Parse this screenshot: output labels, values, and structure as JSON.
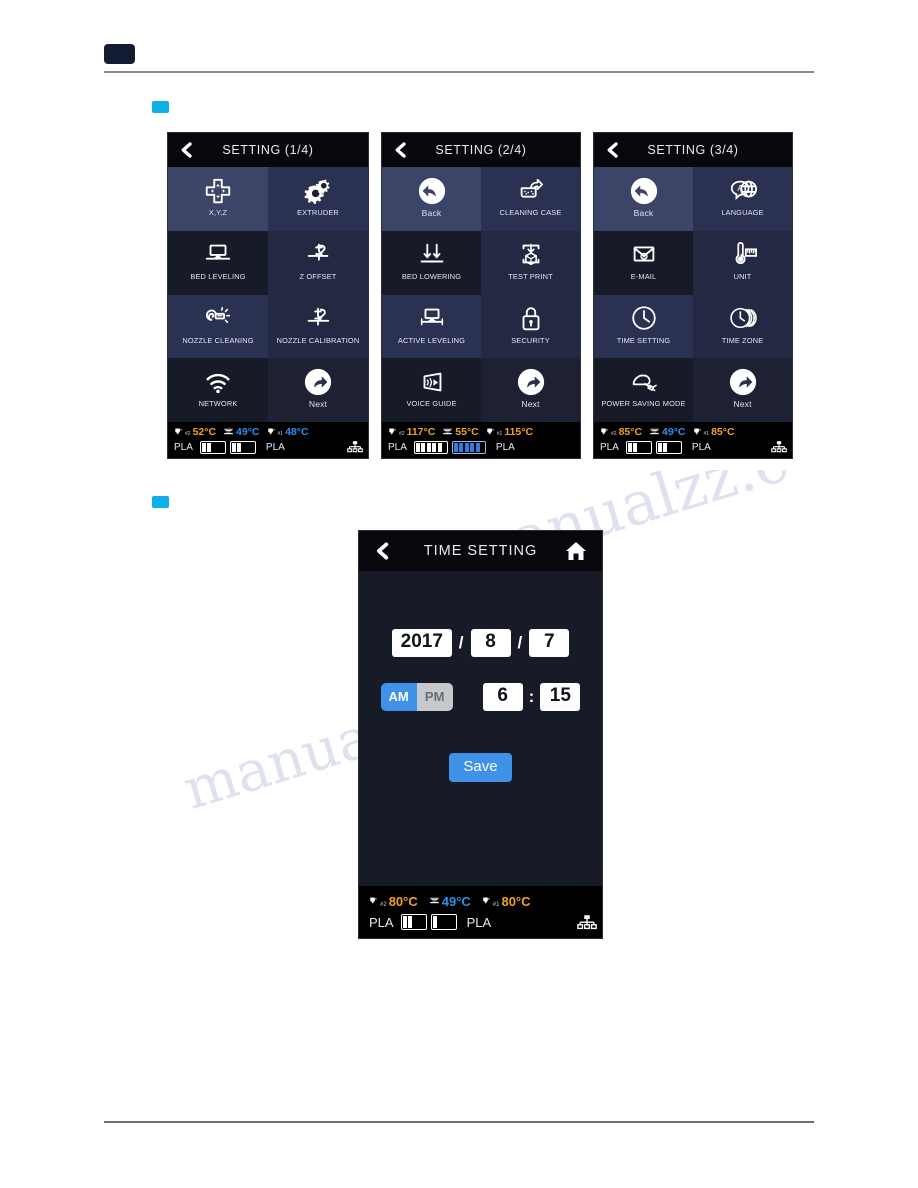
{
  "document": {
    "header_block": "",
    "section_markers": [
      "",
      ""
    ]
  },
  "watermark": {
    "line1": "manualzz",
    "line2": "manualzz.com"
  },
  "screens": [
    {
      "id": "setting-1-4",
      "title": "SETTING (1/4)",
      "back_icon": "chevron-left-icon",
      "tiles": [
        {
          "label": "X,Y,Z",
          "icon": "dpad-icon",
          "shade": "tA",
          "size": "small"
        },
        {
          "label": "EXTRUDER",
          "icon": "gears-icon",
          "shade": "tB",
          "size": "small"
        },
        {
          "label": "BED LEVELING",
          "icon": "bed-leveling-icon",
          "shade": "tC",
          "size": "small"
        },
        {
          "label": "Z OFFSET",
          "icon": "z-offset-icon",
          "shade": "tD",
          "size": "small"
        },
        {
          "label": "NOZZLE CLEANING",
          "icon": "nozzle-cleaning-icon",
          "shade": "tB",
          "size": "small"
        },
        {
          "label": "NOZZLE CALIBRATION",
          "icon": "nozzle-calibration-icon",
          "shade": "tD",
          "size": "small"
        },
        {
          "label": "NETWORK",
          "icon": "wifi-icon",
          "shade": "tC",
          "size": "small"
        },
        {
          "label": "Next",
          "icon": "next-arrow-icon",
          "shade": "tE",
          "size": "mix"
        }
      ],
      "status": {
        "temps": [
          {
            "sub": "#2",
            "value": "52°C",
            "icon": "nozzle-icon",
            "tone": "hot"
          },
          {
            "sub": "",
            "value": "49°C",
            "icon": "bed-icon",
            "tone": "cool"
          },
          {
            "sub": "#1",
            "value": "48°C",
            "icon": "nozzle-icon",
            "tone": "cool"
          }
        ],
        "left_material": "PLA",
        "right_material": "PLA",
        "bar_left_segments": 2,
        "bar_right_segments": 2,
        "bar_left_style": "white",
        "bar_right_style": "white",
        "network_icon": "ethernet-icon",
        "show_network": true
      }
    },
    {
      "id": "setting-2-4",
      "title": "SETTING (2/4)",
      "back_icon": "chevron-left-icon",
      "tiles": [
        {
          "label": "Back",
          "icon": "back-arrow-icon",
          "shade": "tA",
          "size": "mix"
        },
        {
          "label": "CLEANING CASE",
          "icon": "cleaning-case-icon",
          "shade": "tB",
          "size": "small"
        },
        {
          "label": "BED LOWERING",
          "icon": "bed-lowering-icon",
          "shade": "tC",
          "size": "small"
        },
        {
          "label": "TEST PRINT",
          "icon": "test-print-icon",
          "shade": "tD",
          "size": "small"
        },
        {
          "label": "ACTIVE LEVELING",
          "icon": "active-leveling-icon",
          "shade": "tB",
          "size": "small"
        },
        {
          "label": "SECURITY",
          "icon": "lock-icon",
          "shade": "tD",
          "size": "small"
        },
        {
          "label": "VOICE GUIDE",
          "icon": "voice-guide-icon",
          "shade": "tC",
          "size": "small"
        },
        {
          "label": "Next",
          "icon": "next-arrow-icon",
          "shade": "tE",
          "size": "mix"
        }
      ],
      "status": {
        "temps": [
          {
            "sub": "#2",
            "value": "117°C",
            "icon": "nozzle-icon",
            "tone": "hot"
          },
          {
            "sub": "",
            "value": "55°C",
            "icon": "bed-icon",
            "tone": "hot"
          },
          {
            "sub": "#1",
            "value": "115°C",
            "icon": "nozzle-icon",
            "tone": "hot"
          }
        ],
        "left_material": "PLA",
        "right_material": "PLA",
        "bar_left_segments": 5,
        "bar_right_segments": 5,
        "bar_left_style": "white",
        "bar_right_style": "blue",
        "network_icon": "ethernet-icon",
        "show_network": false
      }
    },
    {
      "id": "setting-3-4",
      "title": "SETTING (3/4)",
      "back_icon": "chevron-left-icon",
      "tiles": [
        {
          "label": "Back",
          "icon": "back-arrow-icon",
          "shade": "tA",
          "size": "mix"
        },
        {
          "label": "LANGUAGE",
          "icon": "language-icon",
          "shade": "tB",
          "size": "small"
        },
        {
          "label": "E-MAIL",
          "icon": "email-icon",
          "shade": "tC",
          "size": "small"
        },
        {
          "label": "UNIT",
          "icon": "unit-icon",
          "shade": "tD",
          "size": "small"
        },
        {
          "label": "TIME SETTING",
          "icon": "clock-icon",
          "shade": "tB",
          "size": "small"
        },
        {
          "label": "TIME ZONE",
          "icon": "time-zone-icon",
          "shade": "tD",
          "size": "small"
        },
        {
          "label": "POWER SAVING MODE",
          "icon": "power-plug-icon",
          "shade": "tC",
          "size": "small"
        },
        {
          "label": "Next",
          "icon": "next-arrow-icon",
          "shade": "tE",
          "size": "mix"
        }
      ],
      "status": {
        "temps": [
          {
            "sub": "#2",
            "value": "85°C",
            "icon": "nozzle-icon",
            "tone": "hot"
          },
          {
            "sub": "",
            "value": "49°C",
            "icon": "bed-icon",
            "tone": "cool"
          },
          {
            "sub": "#1",
            "value": "85°C",
            "icon": "nozzle-icon",
            "tone": "hot"
          }
        ],
        "left_material": "PLA",
        "right_material": "PLA",
        "bar_left_segments": 2,
        "bar_right_segments": 2,
        "bar_left_style": "white",
        "bar_right_style": "white",
        "network_icon": "ethernet-icon",
        "show_network": true
      }
    }
  ],
  "time_setting": {
    "title": "TIME SETTING",
    "back_icon": "chevron-left-icon",
    "home_icon": "home-icon",
    "year": "2017",
    "month": "8",
    "day": "7",
    "date_separator": "/",
    "am_label": "AM",
    "pm_label": "PM",
    "meridiem_selected": "AM",
    "hour": "6",
    "minute": "15",
    "time_separator": ":",
    "save_label": "Save",
    "status": {
      "temps": [
        {
          "sub": "#2",
          "value": "80°C",
          "icon": "nozzle-icon",
          "tone": "hot"
        },
        {
          "sub": "",
          "value": "49°C",
          "icon": "bed-icon",
          "tone": "cool"
        },
        {
          "sub": "#1",
          "value": "80°C",
          "icon": "nozzle-icon",
          "tone": "hot"
        }
      ],
      "left_material": "PLA",
      "right_material": "PLA",
      "bar_left_segments": 2,
      "bar_right_segments": 1,
      "bar_left_style": "white",
      "bar_right_style": "white",
      "network_icon": "ethernet-icon",
      "show_network": true
    }
  },
  "colors": {
    "accent_blue": "#3f92e8",
    "marker_cyan": "#0fb0e8",
    "temp_hot": "#f0a21e",
    "temp_cool": "#2b8ff0",
    "screen_bg": "#171a27",
    "titlebar_bg": "#07070c"
  }
}
